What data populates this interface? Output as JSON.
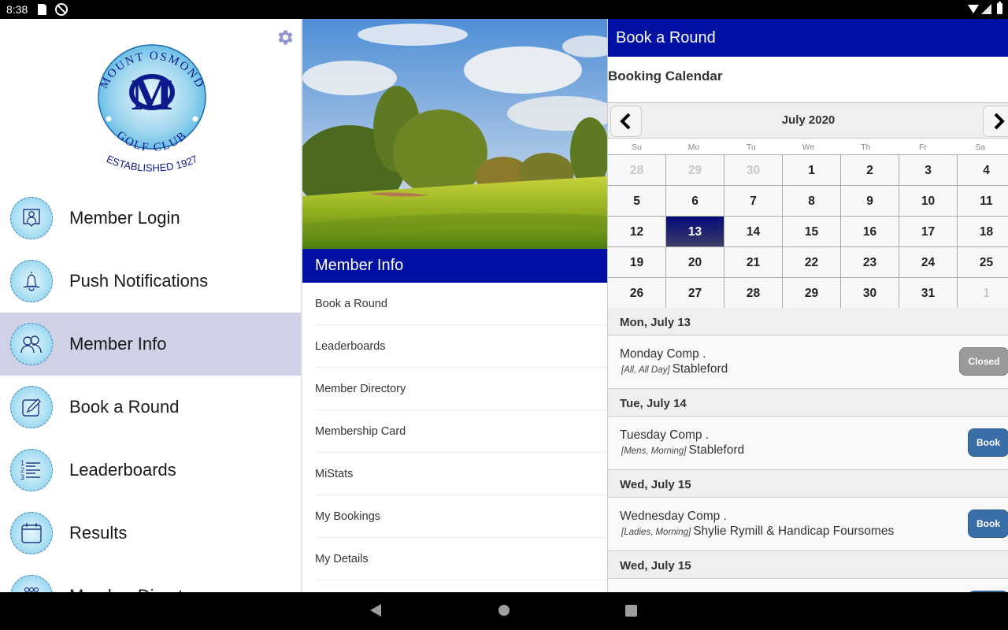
{
  "status_bar": {
    "time": "8:38"
  },
  "drawer": {
    "logo": {
      "top_text": "MOUNT OSMOND",
      "bottom_text": "GOLF CLUB",
      "established": "ESTABLISHED 1927",
      "monogram": "M"
    },
    "items": [
      {
        "label": "Member Login",
        "icon": "member-login-icon",
        "active": false
      },
      {
        "label": "Push Notifications",
        "icon": "bell-icon",
        "active": false
      },
      {
        "label": "Member Info",
        "icon": "members-icon",
        "active": true
      },
      {
        "label": "Book a Round",
        "icon": "pencil-icon",
        "active": false
      },
      {
        "label": "Leaderboards",
        "icon": "ranked-list-icon",
        "active": false
      },
      {
        "label": "Results",
        "icon": "calendar-icon",
        "active": false
      },
      {
        "label": "Member Directory",
        "icon": "group-icon",
        "active": false
      }
    ]
  },
  "middle": {
    "header": "Member Info",
    "items": [
      "Book a Round",
      "Leaderboards",
      "Member Directory",
      "Membership Card",
      "MiStats",
      "My Bookings",
      "My Details"
    ]
  },
  "right": {
    "header": "Book a Round",
    "section_title": "Booking Calendar",
    "calendar": {
      "month_label": "July 2020",
      "weekdays": [
        "Su",
        "Mo",
        "Tu",
        "We",
        "Th",
        "Fr",
        "Sa"
      ],
      "weeks": [
        [
          {
            "d": "28",
            "o": true
          },
          {
            "d": "29",
            "o": true
          },
          {
            "d": "30",
            "o": true
          },
          {
            "d": "1"
          },
          {
            "d": "2"
          },
          {
            "d": "3"
          },
          {
            "d": "4"
          }
        ],
        [
          {
            "d": "5"
          },
          {
            "d": "6"
          },
          {
            "d": "7"
          },
          {
            "d": "8"
          },
          {
            "d": "9"
          },
          {
            "d": "10"
          },
          {
            "d": "11"
          }
        ],
        [
          {
            "d": "12"
          },
          {
            "d": "13",
            "s": true
          },
          {
            "d": "14"
          },
          {
            "d": "15"
          },
          {
            "d": "16"
          },
          {
            "d": "17"
          },
          {
            "d": "18"
          }
        ],
        [
          {
            "d": "19"
          },
          {
            "d": "20"
          },
          {
            "d": "21"
          },
          {
            "d": "22"
          },
          {
            "d": "23"
          },
          {
            "d": "24"
          },
          {
            "d": "25"
          }
        ],
        [
          {
            "d": "26"
          },
          {
            "d": "27"
          },
          {
            "d": "28"
          },
          {
            "d": "29"
          },
          {
            "d": "30"
          },
          {
            "d": "31"
          },
          {
            "d": "1",
            "o": true
          }
        ]
      ],
      "selected_day": "13"
    },
    "events": [
      {
        "date": "Mon, July 13",
        "name": "Monday Comp .",
        "tag": "[All, All Day]",
        "detail": "Stableford",
        "button": "Closed",
        "status": "closed"
      },
      {
        "date": "Tue, July 14",
        "name": "Tuesday Comp .",
        "tag": "[Mens, Morning]",
        "detail": "Stableford",
        "button": "Book",
        "status": "book"
      },
      {
        "date": "Wed, July 15",
        "name": "Wednesday Comp .",
        "tag": "[Ladies, Morning]",
        "detail": "Shylie Rymill & Handicap Foursomes",
        "button": "Book",
        "status": "book"
      },
      {
        "date": "Wed, July 15",
        "name": "",
        "tag": "",
        "detail": "",
        "button": "Book",
        "status": "book"
      }
    ]
  },
  "colors": {
    "header_blue": "#0011a4",
    "selected_day": "#040a7a",
    "book_button": "#3a6ea8",
    "closed_button": "#9a9a9a",
    "active_menu": "#d0d1e6"
  }
}
